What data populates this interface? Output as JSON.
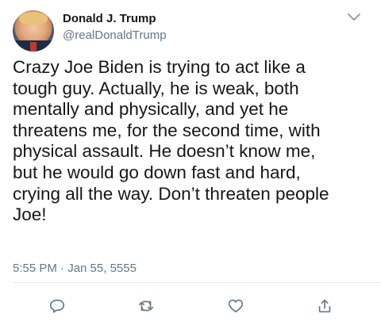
{
  "tweet": {
    "author_name": "Donald J. Trump",
    "author_handle": "@realDonaldTrump",
    "text": "Crazy Joe Biden is trying to act like a\ntough guy. Actually, he is weak, both\nmentally and physically, and yet he\nthreatens me, for the second time, with\nphysical assault. He doesn’t know me,\nbut he would go down fast and hard,\ncrying all the way. Don’t threaten people\nJoe!",
    "timestamp": "5:55 PM · Jan 55, 5555"
  },
  "icons": {
    "more": "chevron-down-icon",
    "reply": "reply-icon",
    "retweet": "retweet-icon",
    "like": "like-icon",
    "share": "share-icon"
  },
  "colors": {
    "text": "#14171a",
    "secondary": "#657786",
    "divider": "#e1e8ed"
  }
}
